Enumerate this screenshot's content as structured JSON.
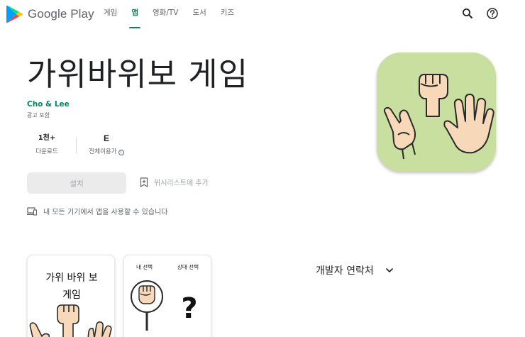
{
  "header": {
    "brand": "Google Play",
    "nav": [
      {
        "label": "게임",
        "active": false
      },
      {
        "label": "앱",
        "active": true
      },
      {
        "label": "영화/TV",
        "active": false
      },
      {
        "label": "도서",
        "active": false
      },
      {
        "label": "키즈",
        "active": false
      }
    ],
    "icons": [
      "search-icon",
      "help-icon"
    ]
  },
  "app": {
    "title": "가위바위보 게임",
    "developer": "Cho & Lee",
    "ads_note": "광고 포함",
    "downloads_value": "1천+",
    "downloads_label": "다운로드",
    "rating_badge": "E",
    "rating_label": "전체이용가",
    "install_label": "설치",
    "wishlist_label": "위시리스트에 추가",
    "devices_note": "내 모든 기기에서 앱을 사용할 수 있습니다"
  },
  "screenshots": {
    "shot1_title_line1": "가위 바위 보",
    "shot1_title_line2": "게임",
    "shot2_label_mine": "내 선택",
    "shot2_label_opponent": "상대 선택"
  },
  "contact": {
    "label": "개발자 연락처"
  },
  "colors": {
    "accent": "#01875f",
    "icon_bg": "#c8dfa0",
    "text_primary": "#202124",
    "text_secondary": "#5f6368",
    "install_bg": "#ebebeb",
    "skin": "#f7d8b8"
  }
}
